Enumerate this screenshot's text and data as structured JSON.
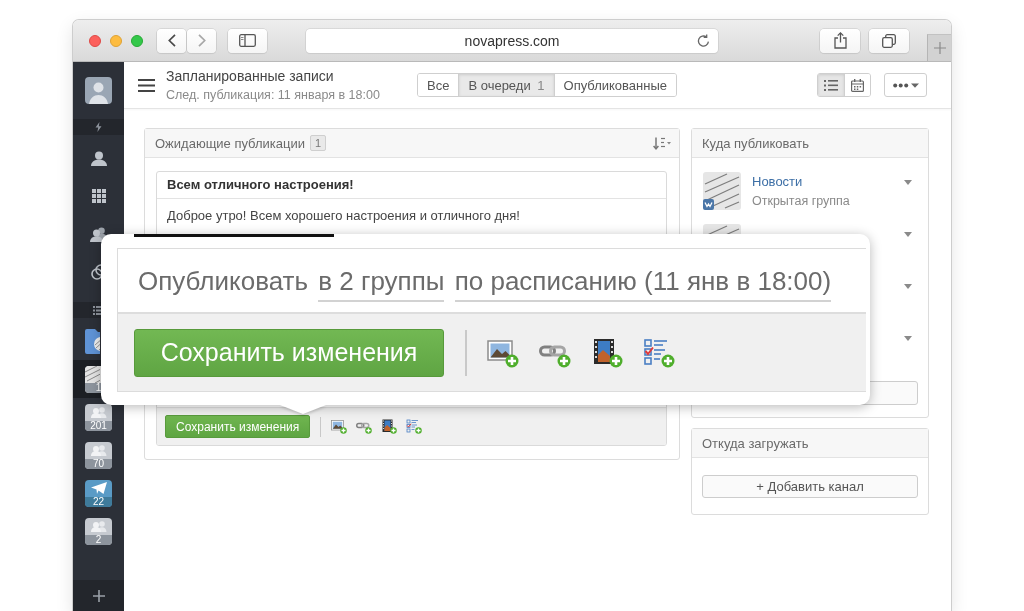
{
  "browser": {
    "url": "novapress.com"
  },
  "sidebar": {
    "channels": [
      {
        "kind": "folder",
        "selected": false
      },
      {
        "kind": "news",
        "badge": "1",
        "selected": true
      },
      {
        "kind": "group",
        "badge": "201",
        "selected": false
      },
      {
        "kind": "group",
        "badge": "70",
        "selected": false
      },
      {
        "kind": "telegram",
        "badge": "22",
        "selected": false
      },
      {
        "kind": "group",
        "badge": "2",
        "selected": false
      }
    ]
  },
  "header": {
    "title": "Запланированные записи",
    "subtitle": "След. публикация: 11 января в 18:00",
    "tabs": [
      {
        "label": "Все",
        "selected": false
      },
      {
        "label": "В очереди",
        "count": "1",
        "selected": true
      },
      {
        "label": "Опубликованные",
        "selected": false
      }
    ],
    "views": [
      {
        "kind": "list",
        "selected": true
      },
      {
        "kind": "calendar",
        "selected": false
      }
    ]
  },
  "pending": {
    "title": "Ожидающие публикации",
    "count": "1",
    "post": {
      "title": "Всем отличного настроения!",
      "text": "Доброе утро! Всем хорошего настроения и отличного дня!"
    },
    "save_button": "Сохранить изменения",
    "attachments": [
      {
        "kind": "image"
      },
      {
        "kind": "link"
      },
      {
        "kind": "film"
      },
      {
        "kind": "checklist"
      }
    ]
  },
  "popup": {
    "lead": "Опубликовать",
    "groups": "в 2 группы",
    "schedule": "по расписанию (11 янв в 18:00)",
    "save_button": "Сохранить изменения",
    "attachments": [
      {
        "kind": "image"
      },
      {
        "kind": "link"
      },
      {
        "kind": "film"
      },
      {
        "kind": "checklist"
      }
    ]
  },
  "targets": {
    "title": "Куда публиковать",
    "channels": [
      {
        "kind": "badged",
        "name": "Новости",
        "subtitle": "Открытая группа"
      },
      {
        "kind": "thumbnail"
      },
      {
        "kind": "covered"
      },
      {
        "kind": "covered"
      }
    ]
  },
  "sources": {
    "title": "Откуда загружать",
    "button": "+ Добавить канал"
  }
}
